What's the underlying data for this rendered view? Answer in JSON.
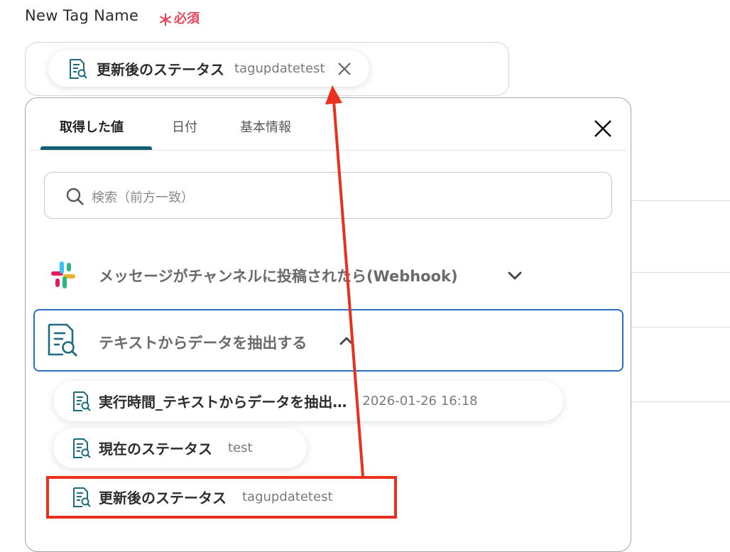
{
  "field": {
    "label": "New Tag Name",
    "required_mark": "＊",
    "required_text": "必須"
  },
  "selected_tag": {
    "name": "更新後のステータス",
    "value": "tagupdatetest"
  },
  "panel": {
    "tabs": [
      {
        "label": "取得した値",
        "active": true
      },
      {
        "label": "日付",
        "active": false
      },
      {
        "label": "基本情報",
        "active": false
      }
    ],
    "search": {
      "placeholder": "検索（前方一致）"
    },
    "sections": [
      {
        "title": "メッセージがチャンネルに投稿されたら(Webhook)",
        "icon": "slack-icon",
        "expanded": false
      },
      {
        "title": "テキストからデータを抽出する",
        "icon": "document-search-icon",
        "expanded": true
      }
    ],
    "items": [
      {
        "name": "実行時間_テキストからデータを抽出…",
        "value": "2026-01-26 16:18"
      },
      {
        "name": "現在のステータス",
        "value": "test"
      },
      {
        "name": "更新後のステータス",
        "value": "tagupdatetest"
      }
    ]
  },
  "colors": {
    "required": "#e24a5b",
    "tab_underline": "#0f5e75",
    "section_border": "#2a70c4",
    "highlight": "#e8321e",
    "icon": "#1d6b80"
  }
}
